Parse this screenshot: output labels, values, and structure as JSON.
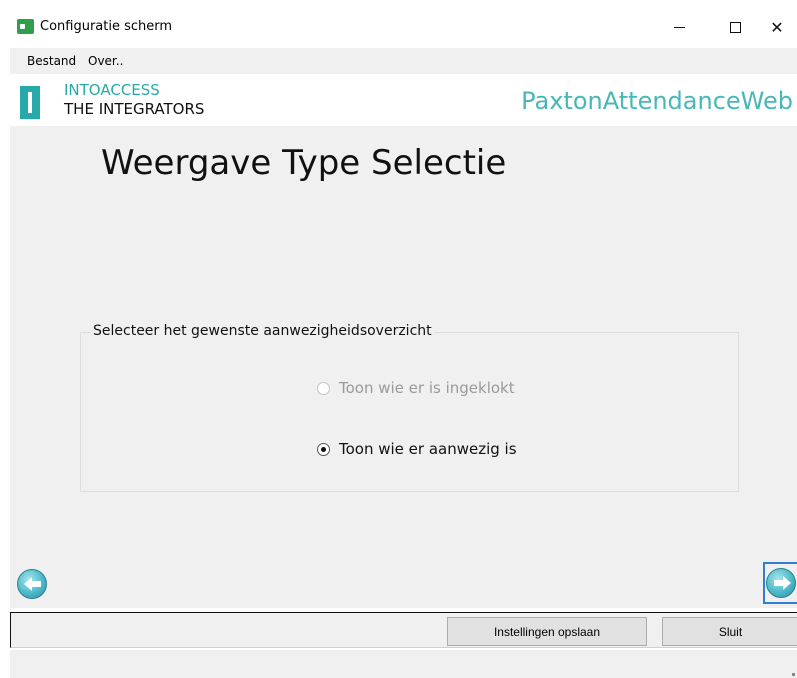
{
  "window": {
    "title": "Configuratie scherm",
    "controls": {
      "minimize": "–",
      "maximize": "☐",
      "close": "✕"
    }
  },
  "menu": {
    "items": [
      {
        "label": "Bestand"
      },
      {
        "label": "Over.."
      }
    ]
  },
  "logo": {
    "line1": "INTOACCESS",
    "line2": "THE INTEGRATORS",
    "brand": "PaxtonAttendanceWeb"
  },
  "page": {
    "heading": "Weergave Type Selectie"
  },
  "group": {
    "legend": "Selecteer het gewenste aanwezigheidsoverzicht",
    "options": [
      {
        "label": "Toon wie er is ingeklokt",
        "checked": false,
        "enabled": false
      },
      {
        "label": "Toon wie er aanwezig is",
        "checked": true,
        "enabled": true
      }
    ]
  },
  "nav": {
    "prev_icon": "arrow-left-circle-icon",
    "next_icon": "arrow-right-circle-icon"
  },
  "buttons": {
    "save": "Instellingen opslaan",
    "close": "Sluit"
  },
  "colors": {
    "brand_teal": "#27a9a9",
    "focus_blue": "#2f7fd0"
  }
}
